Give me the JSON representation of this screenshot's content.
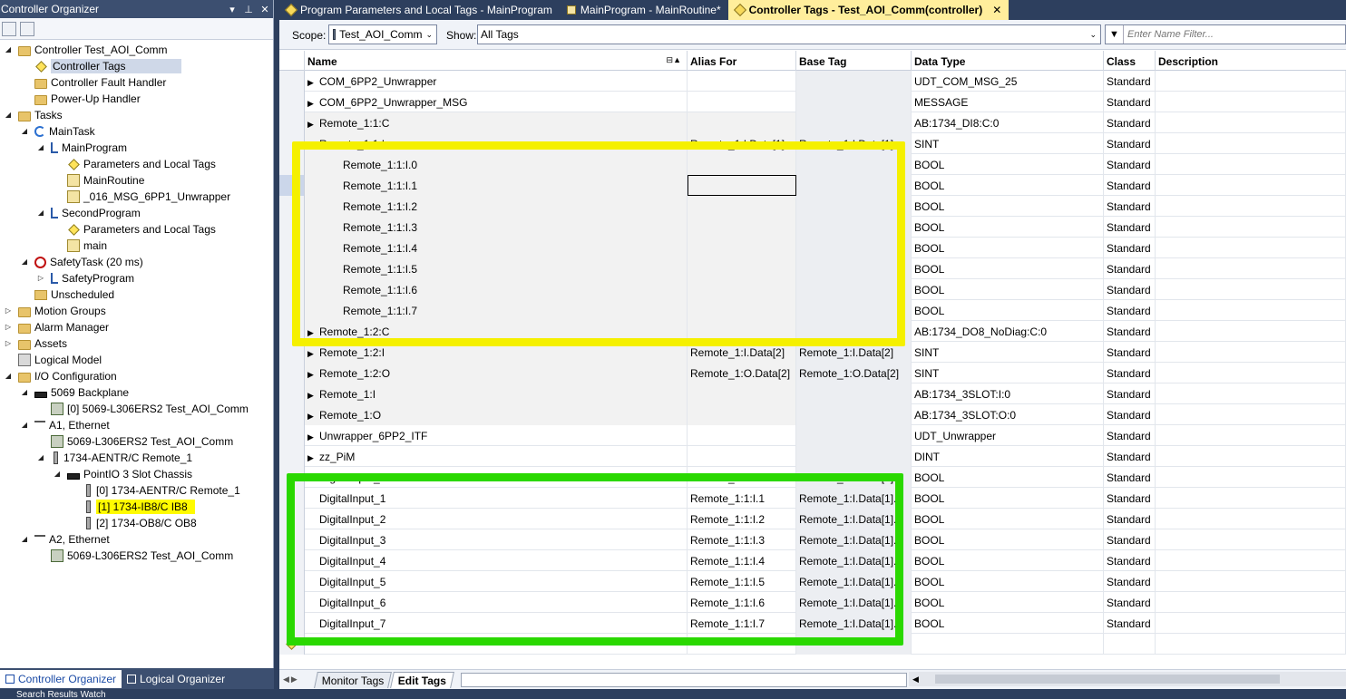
{
  "organizer": {
    "title": "Controller Organizer",
    "title_buttons": [
      "▾",
      "⊥",
      "✕"
    ],
    "tree": [
      {
        "label": "Controller Test_AOI_Comm",
        "icon": "folder",
        "exp": "◢",
        "level": 0
      },
      {
        "label": "Controller Tags",
        "icon": "tag",
        "exp": "",
        "level": 1,
        "selected": true
      },
      {
        "label": "Controller Fault Handler",
        "icon": "folder",
        "exp": "",
        "level": 1
      },
      {
        "label": "Power-Up Handler",
        "icon": "folder",
        "exp": "",
        "level": 1
      },
      {
        "label": "Tasks",
        "icon": "folder",
        "exp": "◢",
        "level": 0
      },
      {
        "label": "MainTask",
        "icon": "task",
        "exp": "◢",
        "level": 1
      },
      {
        "label": "MainProgram",
        "icon": "prog",
        "exp": "◢",
        "level": 2
      },
      {
        "label": "Parameters and Local Tags",
        "icon": "tag",
        "exp": "",
        "level": 3
      },
      {
        "label": "MainRoutine",
        "icon": "routine",
        "exp": "",
        "level": 3
      },
      {
        "label": "_016_MSG_6PP1_Unwrapper",
        "icon": "routine",
        "exp": "",
        "level": 3
      },
      {
        "label": "SecondProgram",
        "icon": "prog",
        "exp": "◢",
        "level": 2
      },
      {
        "label": "Parameters and Local Tags",
        "icon": "tag",
        "exp": "",
        "level": 3
      },
      {
        "label": "main",
        "icon": "routine",
        "exp": "",
        "level": 3
      },
      {
        "label": "SafetyTask (20 ms)",
        "icon": "safety",
        "exp": "◢",
        "level": 1
      },
      {
        "label": "SafetyProgram",
        "icon": "prog",
        "exp": "▷",
        "level": 2
      },
      {
        "label": "Unscheduled",
        "icon": "unsched",
        "exp": "",
        "level": 1
      },
      {
        "label": "Motion Groups",
        "icon": "folder",
        "exp": "▷",
        "level": 0
      },
      {
        "label": "Alarm Manager",
        "icon": "folder",
        "exp": "▷",
        "level": 0
      },
      {
        "label": "Assets",
        "icon": "folder",
        "exp": "▷",
        "level": 0
      },
      {
        "label": "Logical Model",
        "icon": "device",
        "exp": "",
        "level": 0
      },
      {
        "label": "I/O Configuration",
        "icon": "folder",
        "exp": "◢",
        "level": 0
      },
      {
        "label": "5069 Backplane",
        "icon": "rack",
        "exp": "◢",
        "level": 1
      },
      {
        "label": "[0] 5069-L306ERS2 Test_AOI_Comm",
        "icon": "module",
        "exp": "",
        "level": 2
      },
      {
        "label": "A1, Ethernet",
        "icon": "net",
        "exp": "◢",
        "level": 1
      },
      {
        "label": "5069-L306ERS2 Test_AOI_Comm",
        "icon": "module",
        "exp": "",
        "level": 2
      },
      {
        "label": "1734-AENTR/C Remote_1",
        "icon": "slot",
        "exp": "◢",
        "level": 2
      },
      {
        "label": "PointIO 3 Slot Chassis",
        "icon": "rack",
        "exp": "◢",
        "level": 3
      },
      {
        "label": "[0] 1734-AENTR/C Remote_1",
        "icon": "slot",
        "exp": "",
        "level": 4
      },
      {
        "label": "[1] 1734-IB8/C IB8",
        "icon": "slot",
        "exp": "",
        "level": 4,
        "highlight": true
      },
      {
        "label": "[2] 1734-OB8/C OB8",
        "icon": "slot",
        "exp": "",
        "level": 4
      },
      {
        "label": "A2, Ethernet",
        "icon": "net",
        "exp": "◢",
        "level": 1
      },
      {
        "label": "5069-L306ERS2 Test_AOI_Comm",
        "icon": "module",
        "exp": "",
        "level": 2
      }
    ],
    "tabs": [
      {
        "label": "Controller Organizer",
        "active": true
      },
      {
        "label": "Logical Organizer",
        "active": false
      }
    ]
  },
  "doc_tabs": [
    {
      "label": "Program Parameters and Local Tags - MainProgram",
      "active": false
    },
    {
      "label": "MainProgram - MainRoutine*",
      "active": false
    },
    {
      "label": "Controller Tags - Test_AOI_Comm(controller)",
      "active": true,
      "close": "✕"
    }
  ],
  "scope_bar": {
    "scope_label": "Scope:",
    "scope_value": "Test_AOI_Comm",
    "show_label": "Show:",
    "show_value": "All Tags",
    "filter_placeholder": "Enter Name Filter...",
    "dropdown_glyph": "⌄"
  },
  "columns": {
    "name": "Name",
    "alias": "Alias For",
    "base": "Base Tag",
    "type": "Data Type",
    "class": "Class",
    "desc": "Description",
    "sort_glyph": "⊟▲"
  },
  "tags": [
    {
      "exp": "▶",
      "indent": 0,
      "name": "COM_6PP2_Unwrapper",
      "alias": "",
      "base": "",
      "type": "UDT_COM_MSG_25",
      "class": "Standard"
    },
    {
      "exp": "▶",
      "indent": 0,
      "name": "COM_6PP2_Unwrapper_MSG",
      "alias": "",
      "base": "",
      "type": "MESSAGE",
      "class": "Standard"
    },
    {
      "exp": "▶",
      "indent": 0,
      "name": "Remote_1:1:C",
      "alias": "",
      "base": "",
      "type": "AB:1734_DI8:C:0",
      "class": "Standard",
      "grey": true
    },
    {
      "exp": "◢",
      "indent": 0,
      "name": "Remote_1:1:I",
      "alias": "Remote_1:I.Data[1]",
      "base": "Remote_1:I.Data[1]",
      "type": "SINT",
      "class": "Standard",
      "grey": true
    },
    {
      "exp": "",
      "indent": 1,
      "name": "Remote_1:1:I.0",
      "alias": "",
      "base": "",
      "type": "BOOL",
      "class": "Standard",
      "grey": true
    },
    {
      "exp": "",
      "indent": 1,
      "name": "Remote_1:1:I.1",
      "alias": "",
      "base": "",
      "type": "BOOL",
      "class": "Standard",
      "grey": true,
      "current": true
    },
    {
      "exp": "",
      "indent": 1,
      "name": "Remote_1:1:I.2",
      "alias": "",
      "base": "",
      "type": "BOOL",
      "class": "Standard",
      "grey": true
    },
    {
      "exp": "",
      "indent": 1,
      "name": "Remote_1:1:I.3",
      "alias": "",
      "base": "",
      "type": "BOOL",
      "class": "Standard",
      "grey": true
    },
    {
      "exp": "",
      "indent": 1,
      "name": "Remote_1:1:I.4",
      "alias": "",
      "base": "",
      "type": "BOOL",
      "class": "Standard",
      "grey": true
    },
    {
      "exp": "",
      "indent": 1,
      "name": "Remote_1:1:I.5",
      "alias": "",
      "base": "",
      "type": "BOOL",
      "class": "Standard",
      "grey": true
    },
    {
      "exp": "",
      "indent": 1,
      "name": "Remote_1:1:I.6",
      "alias": "",
      "base": "",
      "type": "BOOL",
      "class": "Standard",
      "grey": true
    },
    {
      "exp": "",
      "indent": 1,
      "name": "Remote_1:1:I.7",
      "alias": "",
      "base": "",
      "type": "BOOL",
      "class": "Standard",
      "grey": true
    },
    {
      "exp": "▶",
      "indent": 0,
      "name": "Remote_1:2:C",
      "alias": "",
      "base": "",
      "type": "AB:1734_DO8_NoDiag:C:0",
      "class": "Standard",
      "grey": true
    },
    {
      "exp": "▶",
      "indent": 0,
      "name": "Remote_1:2:I",
      "alias": "Remote_1:I.Data[2]",
      "base": "Remote_1:I.Data[2]",
      "type": "SINT",
      "class": "Standard",
      "grey": true
    },
    {
      "exp": "▶",
      "indent": 0,
      "name": "Remote_1:2:O",
      "alias": "Remote_1:O.Data[2]",
      "base": "Remote_1:O.Data[2]",
      "type": "SINT",
      "class": "Standard",
      "grey": true
    },
    {
      "exp": "▶",
      "indent": 0,
      "name": "Remote_1:I",
      "alias": "",
      "base": "",
      "type": "AB:1734_3SLOT:I:0",
      "class": "Standard",
      "grey": true
    },
    {
      "exp": "▶",
      "indent": 0,
      "name": "Remote_1:O",
      "alias": "",
      "base": "",
      "type": "AB:1734_3SLOT:O:0",
      "class": "Standard",
      "grey": true
    },
    {
      "exp": "▶",
      "indent": 0,
      "name": "Unwrapper_6PP2_ITF",
      "alias": "",
      "base": "",
      "type": "UDT_Unwrapper",
      "class": "Standard"
    },
    {
      "exp": "▶",
      "indent": 0,
      "name": "zz_PiM",
      "alias": "",
      "base": "",
      "type": "DINT",
      "class": "Standard"
    },
    {
      "exp": "",
      "indent": 0,
      "name": "DigitalInput_0",
      "alias": "Remote_1:1:I.0",
      "base": "Remote_1:I.Data[1].0",
      "type": "BOOL",
      "class": "Standard"
    },
    {
      "exp": "",
      "indent": 0,
      "name": "DigitalInput_1",
      "alias": "Remote_1:1:I.1",
      "base": "Remote_1:I.Data[1].1",
      "type": "BOOL",
      "class": "Standard"
    },
    {
      "exp": "",
      "indent": 0,
      "name": "DigitalInput_2",
      "alias": "Remote_1:1:I.2",
      "base": "Remote_1:I.Data[1].2",
      "type": "BOOL",
      "class": "Standard"
    },
    {
      "exp": "",
      "indent": 0,
      "name": "DigitalInput_3",
      "alias": "Remote_1:1:I.3",
      "base": "Remote_1:I.Data[1].3",
      "type": "BOOL",
      "class": "Standard"
    },
    {
      "exp": "",
      "indent": 0,
      "name": "DigitalInput_4",
      "alias": "Remote_1:1:I.4",
      "base": "Remote_1:I.Data[1].4",
      "type": "BOOL",
      "class": "Standard"
    },
    {
      "exp": "",
      "indent": 0,
      "name": "DigitalInput_5",
      "alias": "Remote_1:1:I.5",
      "base": "Remote_1:I.Data[1].5",
      "type": "BOOL",
      "class": "Standard"
    },
    {
      "exp": "",
      "indent": 0,
      "name": "DigitalInput_6",
      "alias": "Remote_1:1:I.6",
      "base": "Remote_1:I.Data[1].6",
      "type": "BOOL",
      "class": "Standard"
    },
    {
      "exp": "",
      "indent": 0,
      "name": "DigitalInput_7",
      "alias": "Remote_1:1:I.7",
      "base": "Remote_1:I.Data[1].7",
      "type": "BOOL",
      "class": "Standard"
    }
  ],
  "bottom_tabs": [
    {
      "label": "Monitor Tags",
      "active": false
    },
    {
      "label": "Edit Tags",
      "active": true
    }
  ],
  "status_strip": "Search Results   Watch",
  "colors": {
    "highlight_yellow": "#f5f000",
    "highlight_green": "#2ad800",
    "active_tab": "#ffee9c",
    "frame": "#2d3f5e"
  }
}
